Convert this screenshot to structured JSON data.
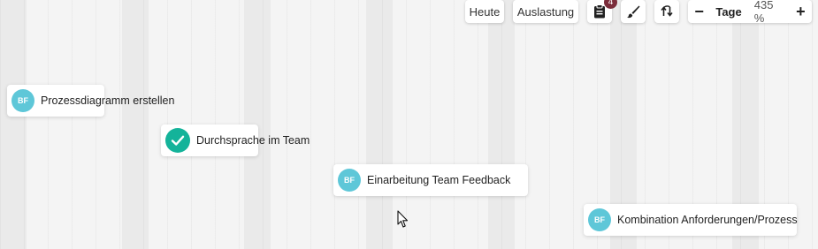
{
  "toolbar": {
    "today_label": "Heute",
    "workload_label": "Auslastung",
    "clipboard_badge": "4",
    "zoom_unit_label": "Tage",
    "zoom_value": "435 %",
    "zoom_out_symbol": "−",
    "zoom_in_symbol": "+"
  },
  "tasks": [
    {
      "label": "Prozessdiagramm erstellen",
      "avatar": "BF",
      "status": "open"
    },
    {
      "label": "Durchsprache im Team",
      "avatar": "",
      "status": "done"
    },
    {
      "label": "Einarbeitung Team Feedback",
      "avatar": "BF",
      "status": "open"
    },
    {
      "label": "Kombination Anforderungen/Prozess",
      "avatar": "BF",
      "status": "open"
    }
  ],
  "colors": {
    "avatar": "#5ec7d8",
    "done": "#14b39a",
    "badge": "#7b2d3b",
    "background": "#f3f3f3"
  },
  "icons": {
    "clipboard": "clipboard-icon",
    "brush": "brush-icon",
    "sort": "sort-arrows-icon",
    "check": "check-icon",
    "cursor": "mouse-pointer-icon"
  }
}
